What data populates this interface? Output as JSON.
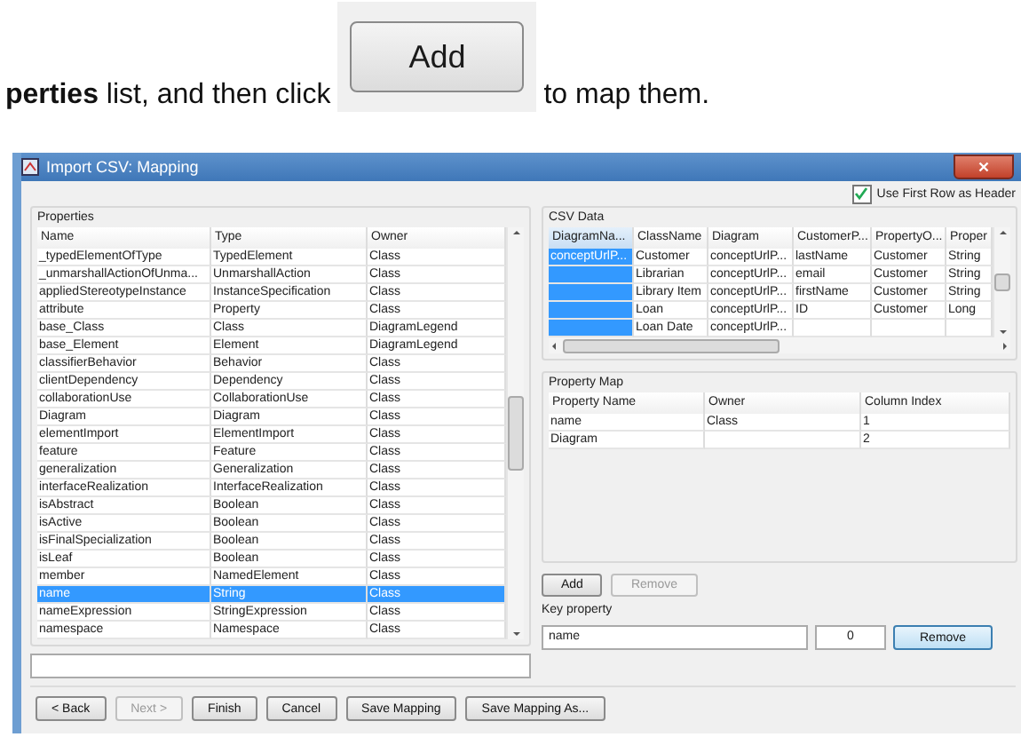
{
  "intro": {
    "lead": "**perties** list, and then click",
    "button": "Add",
    "tail": "to map them."
  },
  "window": {
    "title": "Import CSV: Mapping"
  },
  "header_option": {
    "label": "Use First Row as Header",
    "checked": true
  },
  "properties": {
    "title": "Properties",
    "columns": [
      "Name",
      "Type",
      "Owner"
    ],
    "rows": [
      {
        "cells": [
          "_typedElementOfType",
          "TypedElement",
          "Class"
        ],
        "selected": false
      },
      {
        "cells": [
          "_unmarshallActionOfUnma...",
          "UnmarshallAction",
          "Class"
        ],
        "selected": false
      },
      {
        "cells": [
          "appliedStereotypeInstance",
          "InstanceSpecification",
          "Class"
        ],
        "selected": false
      },
      {
        "cells": [
          "attribute",
          "Property",
          "Class"
        ],
        "selected": false
      },
      {
        "cells": [
          "base_Class",
          "Class",
          "DiagramLegend"
        ],
        "selected": false
      },
      {
        "cells": [
          "base_Element",
          "Element",
          "DiagramLegend"
        ],
        "selected": false
      },
      {
        "cells": [
          "classifierBehavior",
          "Behavior",
          "Class"
        ],
        "selected": false
      },
      {
        "cells": [
          "clientDependency",
          "Dependency",
          "Class"
        ],
        "selected": false
      },
      {
        "cells": [
          "collaborationUse",
          "CollaborationUse",
          "Class"
        ],
        "selected": false
      },
      {
        "cells": [
          "Diagram",
          "Diagram",
          "Class"
        ],
        "selected": false
      },
      {
        "cells": [
          "elementImport",
          "ElementImport",
          "Class"
        ],
        "selected": false
      },
      {
        "cells": [
          "feature",
          "Feature",
          "Class"
        ],
        "selected": false
      },
      {
        "cells": [
          "generalization",
          "Generalization",
          "Class"
        ],
        "selected": false
      },
      {
        "cells": [
          "interfaceRealization",
          "InterfaceRealization",
          "Class"
        ],
        "selected": false
      },
      {
        "cells": [
          "isAbstract",
          "Boolean",
          "Class"
        ],
        "selected": false
      },
      {
        "cells": [
          "isActive",
          "Boolean",
          "Class"
        ],
        "selected": false
      },
      {
        "cells": [
          "isFinalSpecialization",
          "Boolean",
          "Class"
        ],
        "selected": false
      },
      {
        "cells": [
          "isLeaf",
          "Boolean",
          "Class"
        ],
        "selected": false
      },
      {
        "cells": [
          "member",
          "NamedElement",
          "Class"
        ],
        "selected": false
      },
      {
        "cells": [
          "name",
          "String",
          "Class"
        ],
        "selected": true
      },
      {
        "cells": [
          "nameExpression",
          "StringExpression",
          "Class"
        ],
        "selected": false
      },
      {
        "cells": [
          "namespace",
          "Namespace",
          "Class"
        ],
        "selected": false
      }
    ]
  },
  "csv_data": {
    "title": "CSV Data",
    "columns": [
      {
        "label": "DiagramNa...",
        "selected": true
      },
      {
        "label": "ClassName",
        "selected": false
      },
      {
        "label": "Diagram",
        "selected": false
      },
      {
        "label": "CustomerP...",
        "selected": false
      },
      {
        "label": "PropertyO...",
        "selected": false
      },
      {
        "label": "Proper",
        "selected": false
      }
    ],
    "rows": [
      [
        "conceptUrlP...",
        "Customer",
        "conceptUrlP...",
        "lastName",
        "Customer",
        "String"
      ],
      [
        "",
        "Librarian",
        "conceptUrlP...",
        "email",
        "Customer",
        "String"
      ],
      [
        "",
        "Library Item",
        "conceptUrlP...",
        "firstName",
        "Customer",
        "String"
      ],
      [
        "",
        "Loan",
        "conceptUrlP...",
        "ID",
        "Customer",
        "Long"
      ],
      [
        "",
        "Loan Date",
        "conceptUrlP...",
        "",
        "",
        ""
      ]
    ]
  },
  "property_map": {
    "title": "Property Map",
    "columns": [
      "Property Name",
      "Owner",
      "Column Index"
    ],
    "rows": [
      [
        "name",
        "Class",
        "1"
      ],
      [
        "Diagram",
        "",
        "2"
      ]
    ]
  },
  "map_buttons": [
    {
      "label": "Add",
      "disabled": false
    },
    {
      "label": "Remove",
      "disabled": true
    }
  ],
  "key_property": {
    "label": "Key property",
    "value": "name",
    "index": "0",
    "button": "Remove"
  },
  "footer_buttons": [
    {
      "label": "< Back",
      "disabled": false
    },
    {
      "label": "Next >",
      "disabled": true
    },
    {
      "label": "Finish",
      "disabled": false
    },
    {
      "label": "Cancel",
      "disabled": false
    },
    {
      "label": "Save Mapping",
      "disabled": false
    },
    {
      "label": "Save Mapping As...",
      "disabled": false
    }
  ]
}
